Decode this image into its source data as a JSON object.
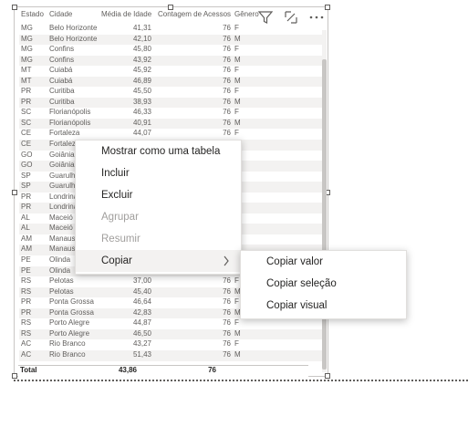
{
  "table": {
    "headers": [
      "Estado",
      "Cidade",
      "Média de Idade",
      "Contagem de Acessos",
      "Gênero"
    ],
    "rows": [
      [
        "MG",
        "Belo Horizonte",
        "41,31",
        "76",
        "F"
      ],
      [
        "MG",
        "Belo Horizonte",
        "42,10",
        "76",
        "M"
      ],
      [
        "MG",
        "Confins",
        "45,80",
        "76",
        "F"
      ],
      [
        "MG",
        "Confins",
        "43,92",
        "76",
        "M"
      ],
      [
        "MT",
        "Cuiabá",
        "45,92",
        "76",
        "F"
      ],
      [
        "MT",
        "Cuiabá",
        "46,89",
        "76",
        "M"
      ],
      [
        "PR",
        "Curitiba",
        "45,50",
        "76",
        "F"
      ],
      [
        "PR",
        "Curitiba",
        "38,93",
        "76",
        "M"
      ],
      [
        "SC",
        "Florianópolis",
        "46,33",
        "76",
        "F"
      ],
      [
        "SC",
        "Florianópolis",
        "40,91",
        "76",
        "M"
      ],
      [
        "CE",
        "Fortaleza",
        "44,07",
        "76",
        "F"
      ],
      [
        "CE",
        "Fortaleza",
        "",
        "",
        ""
      ],
      [
        "GO",
        "Goiânia",
        "",
        "",
        ""
      ],
      [
        "GO",
        "Goiânia",
        "",
        "",
        ""
      ],
      [
        "SP",
        "Guarulhos",
        "",
        "",
        ""
      ],
      [
        "SP",
        "Guarulhos",
        "",
        "",
        ""
      ],
      [
        "PR",
        "Londrina",
        "",
        "",
        ""
      ],
      [
        "PR",
        "Londrina",
        "",
        "",
        ""
      ],
      [
        "AL",
        "Maceió",
        "",
        "",
        ""
      ],
      [
        "AL",
        "Maceió",
        "",
        "",
        ""
      ],
      [
        "AM",
        "Manaus",
        "",
        "",
        ""
      ],
      [
        "AM",
        "Manaus",
        "",
        "",
        ""
      ],
      [
        "PE",
        "Olinda",
        "",
        "",
        ""
      ],
      [
        "PE",
        "Olinda",
        "42,75",
        "76",
        "M"
      ],
      [
        "RS",
        "Pelotas",
        "37,00",
        "76",
        "F"
      ],
      [
        "RS",
        "Pelotas",
        "45,40",
        "76",
        "M"
      ],
      [
        "PR",
        "Ponta Grossa",
        "46,64",
        "76",
        "F"
      ],
      [
        "PR",
        "Ponta Grossa",
        "42,83",
        "76",
        "M"
      ],
      [
        "RS",
        "Porto Alegre",
        "44,87",
        "76",
        "F"
      ],
      [
        "RS",
        "Porto Alegre",
        "46,50",
        "76",
        "M"
      ],
      [
        "AC",
        "Rio Branco",
        "43,27",
        "76",
        "F"
      ],
      [
        "AC",
        "Rio Branco",
        "51,43",
        "76",
        "M"
      ]
    ],
    "total": {
      "label": "Total",
      "media": "43,86",
      "contagem": "76"
    }
  },
  "icons": {
    "filter": "filter-icon",
    "focus": "focus-mode-icon",
    "more": "more-options-icon"
  },
  "context_menu": {
    "items": [
      {
        "label": "Mostrar como uma tabela",
        "state": "enabled"
      },
      {
        "label": "Incluir",
        "state": "enabled"
      },
      {
        "label": "Excluir",
        "state": "enabled"
      },
      {
        "label": "Agrupar",
        "state": "disabled"
      },
      {
        "label": "Resumir",
        "state": "disabled"
      },
      {
        "label": "Copiar",
        "state": "active"
      }
    ],
    "submenu": [
      {
        "label": "Copiar valor"
      },
      {
        "label": "Copiar seleção"
      },
      {
        "label": "Copiar visual"
      }
    ]
  },
  "colors": {
    "accent": "#252423",
    "disabled": "#a19f9d",
    "border": "#c8c6c4"
  }
}
